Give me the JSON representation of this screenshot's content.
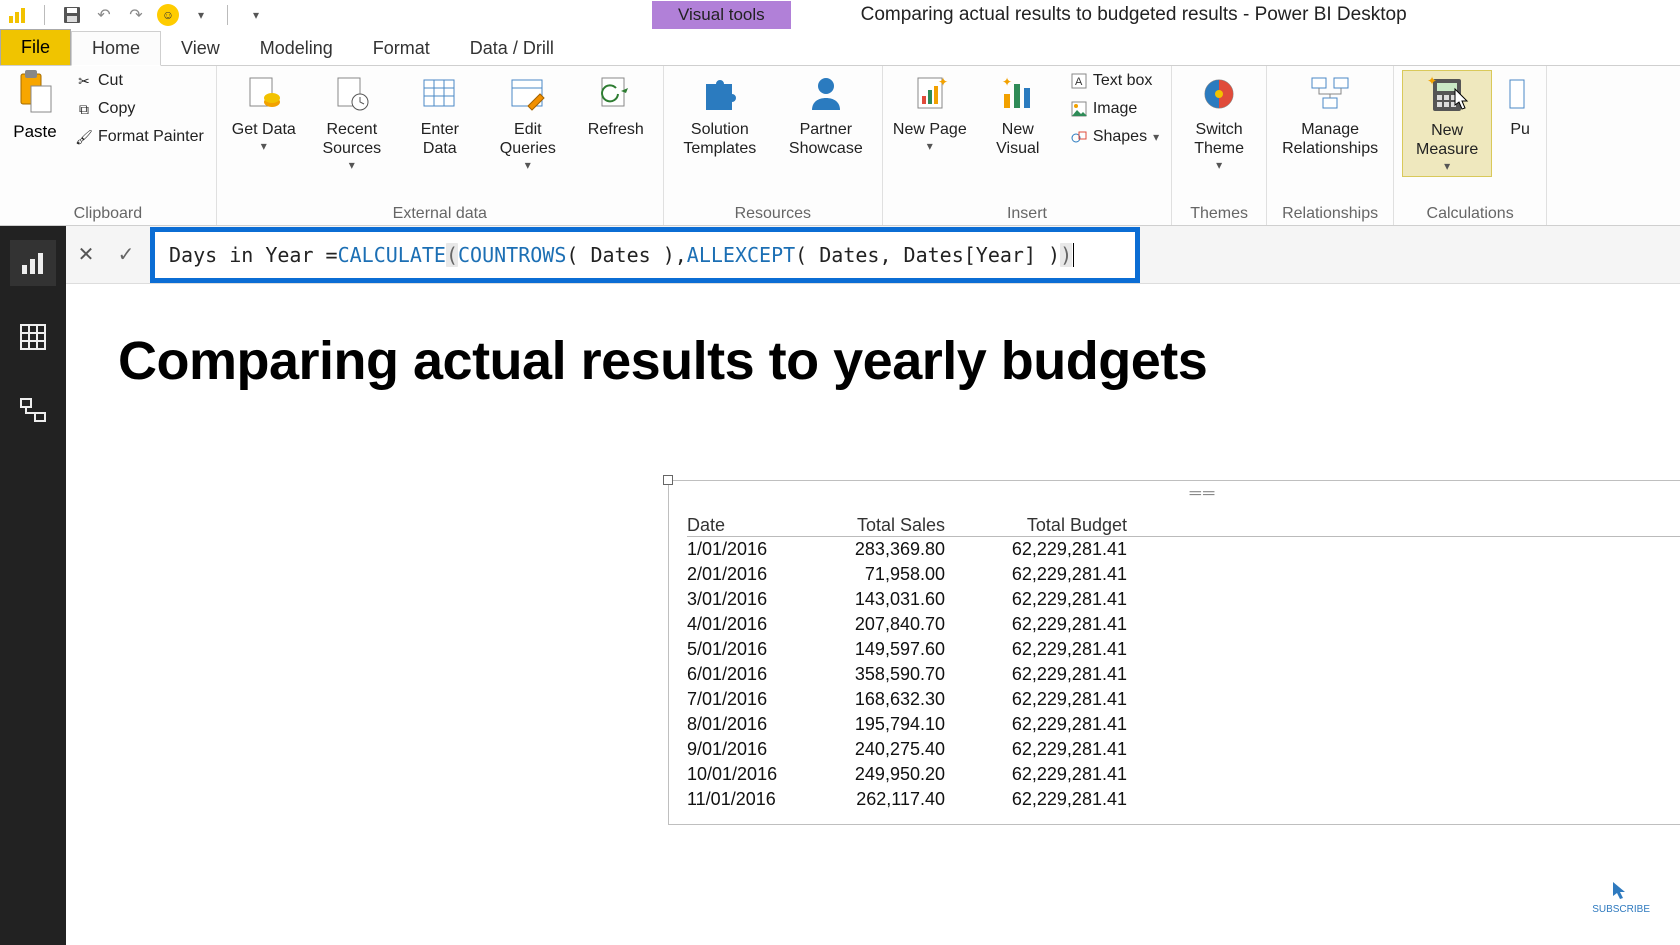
{
  "titlebar": {
    "contextual_tab": "Visual tools",
    "title": "Comparing actual results to budgeted results - Power BI Desktop"
  },
  "tabs": {
    "file": "File",
    "home": "Home",
    "view": "View",
    "modeling": "Modeling",
    "format": "Format",
    "data_drill": "Data / Drill"
  },
  "ribbon": {
    "clipboard": {
      "paste": "Paste",
      "cut": "Cut",
      "copy": "Copy",
      "format_painter": "Format Painter",
      "group": "Clipboard"
    },
    "external": {
      "get_data": "Get Data",
      "recent_sources": "Recent Sources",
      "enter_data": "Enter Data",
      "edit_queries": "Edit Queries",
      "refresh": "Refresh",
      "group": "External data"
    },
    "resources": {
      "solution_templates": "Solution Templates",
      "partner_showcase": "Partner Showcase",
      "group": "Resources"
    },
    "insert": {
      "new_page": "New Page",
      "new_visual": "New Visual",
      "text_box": "Text box",
      "image": "Image",
      "shapes": "Shapes",
      "group": "Insert"
    },
    "themes": {
      "switch_theme": "Switch Theme",
      "group": "Themes"
    },
    "relationships": {
      "manage": "Manage Relationships",
      "group": "Relationships"
    },
    "calculations": {
      "new_measure": "New Measure",
      "group": "Calculations"
    },
    "pu": "Pu"
  },
  "formula": {
    "prefix": "Days in Year = ",
    "calc": "CALCULATE",
    "p_open1": "(",
    "space1": " ",
    "countrows": "COUNTROWS",
    "args1": "( Dates )",
    "comma": ", ",
    "allexcept": "ALLEXCEPT",
    "args2": "( Dates, Dates[Year] ) ",
    "p_close2": ")"
  },
  "page_title": "Comparing actual results to yearly budgets",
  "table": {
    "headers": {
      "c1": "Date",
      "c2": "Total Sales",
      "c3": "Total Budget"
    },
    "rows": [
      {
        "c1": "1/01/2016",
        "c2": "283,369.80",
        "c3": "62,229,281.41"
      },
      {
        "c1": "2/01/2016",
        "c2": "71,958.00",
        "c3": "62,229,281.41"
      },
      {
        "c1": "3/01/2016",
        "c2": "143,031.60",
        "c3": "62,229,281.41"
      },
      {
        "c1": "4/01/2016",
        "c2": "207,840.70",
        "c3": "62,229,281.41"
      },
      {
        "c1": "5/01/2016",
        "c2": "149,597.60",
        "c3": "62,229,281.41"
      },
      {
        "c1": "6/01/2016",
        "c2": "358,590.70",
        "c3": "62,229,281.41"
      },
      {
        "c1": "7/01/2016",
        "c2": "168,632.30",
        "c3": "62,229,281.41"
      },
      {
        "c1": "8/01/2016",
        "c2": "195,794.10",
        "c3": "62,229,281.41"
      },
      {
        "c1": "9/01/2016",
        "c2": "240,275.40",
        "c3": "62,229,281.41"
      },
      {
        "c1": "10/01/2016",
        "c2": "249,950.20",
        "c3": "62,229,281.41"
      },
      {
        "c1": "11/01/2016",
        "c2": "262,117.40",
        "c3": "62,229,281.41"
      }
    ]
  },
  "subscribe": "SUBSCRIBE"
}
